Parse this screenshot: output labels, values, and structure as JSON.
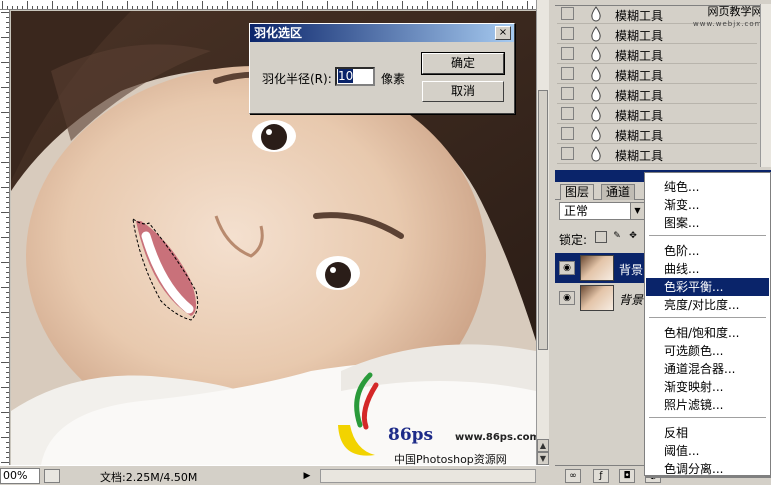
{
  "dialog": {
    "title": "羽化选区",
    "close": "×",
    "feather_label": "羽化半径(R):",
    "feather_value": "10",
    "unit": "像素",
    "ok": "确定",
    "cancel": "取消"
  },
  "status": {
    "zoom": "00%",
    "doc_info": "文档:2.25M/4.50M",
    "arrow": "▶"
  },
  "watermark": {
    "site_name": "网页教学网",
    "site_url": "www.webjx.com",
    "logo_text": "86ps",
    "logo_url": "www.86ps.com",
    "logo_cn": "中国Photoshop资源网"
  },
  "history": {
    "items": [
      {
        "label": "模糊工具"
      },
      {
        "label": "模糊工具"
      },
      {
        "label": "模糊工具"
      },
      {
        "label": "模糊工具"
      },
      {
        "label": "模糊工具"
      },
      {
        "label": "模糊工具"
      },
      {
        "label": "模糊工具"
      },
      {
        "label": "模糊工具"
      }
    ]
  },
  "layers": {
    "tab_layers": "图层",
    "tab_channels": "通道",
    "blend_mode": "正常",
    "lock_label": "锁定:",
    "items": [
      {
        "name": "背景"
      },
      {
        "name": "背景"
      }
    ]
  },
  "menu": {
    "items": [
      {
        "label": "纯色..."
      },
      {
        "label": "渐变..."
      },
      {
        "label": "图案..."
      },
      {
        "label": "色阶..."
      },
      {
        "label": "曲线..."
      },
      {
        "label": "色彩平衡...",
        "selected": true
      },
      {
        "label": "亮度/对比度..."
      },
      {
        "label": "色相/饱和度..."
      },
      {
        "label": "可选颜色..."
      },
      {
        "label": "通道混合器..."
      },
      {
        "label": "渐变映射..."
      },
      {
        "label": "照片滤镜..."
      },
      {
        "label": "反相"
      },
      {
        "label": "阈值..."
      },
      {
        "label": "色调分离..."
      }
    ]
  },
  "colors": {
    "selection": "#0a246a",
    "face": "#d4d0c8"
  }
}
